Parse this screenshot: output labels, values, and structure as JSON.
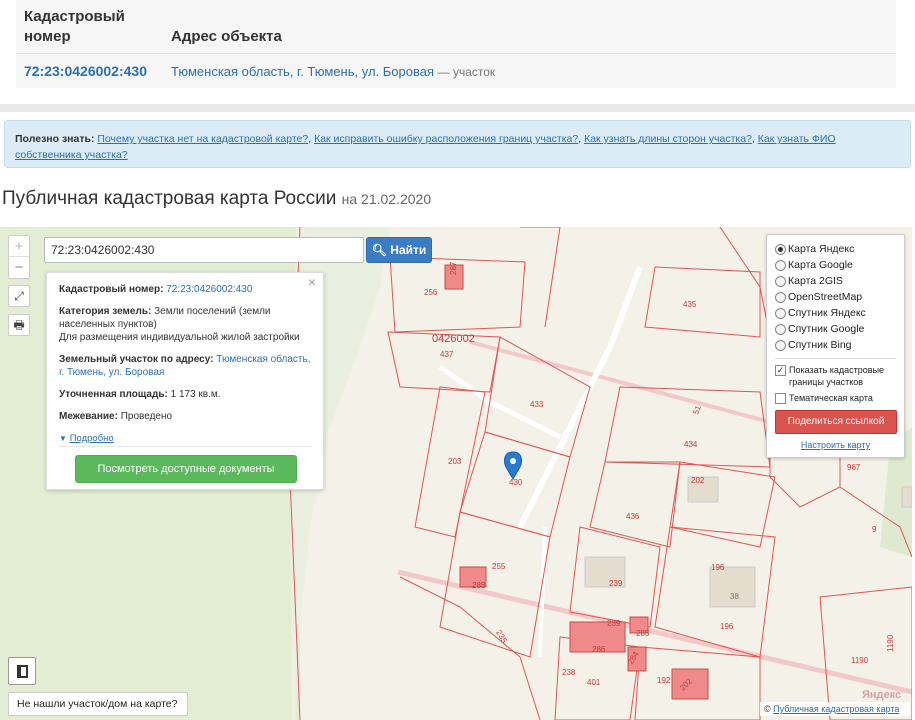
{
  "table": {
    "col_num": "Кадастровый номер",
    "col_addr": "Адрес объекта",
    "row_num": "72:23:0426002:430",
    "row_addr": "Тюменская область, г. Тюмень, ул. Боровая",
    "row_suffix": "— участок"
  },
  "info": {
    "label": "Полезно знать:",
    "link1": "Почему участка нет на кадастровой карте?",
    "link2": "Как исправить ошибку расположения границ участка?",
    "link3": "Как узнать длины сторон участка?",
    "link4": "Как узнать ФИО собственника участка?"
  },
  "title": {
    "main": "Публичная кадастровая карта России",
    "date": "на 21.02.2020"
  },
  "map": {
    "search_value": "72:23:0426002:430",
    "search_button": "Найти",
    "zoom_in": "+",
    "zoom_out": "−",
    "fullscreen_icon": "⤢",
    "print_icon": "🖶",
    "popup": {
      "num_label": "Кадастровый номер:",
      "num_value": "72:23:0426002:430",
      "cat_label": "Категория земель:",
      "cat_value": "Земли поселений (земли населенных пунктов)",
      "use_value": "Для размещения индивидуальной жилой застройки",
      "addr_label": "Земельный участок по адресу:",
      "addr_value": "Тюменская область, г. Тюмень, ул. Боровая",
      "area_label": "Уточненная площадь:",
      "area_value": "1 173 кв.м.",
      "survey_label": "Межевание:",
      "survey_value": "Проведено",
      "more": "Подробно",
      "docs_button": "Посмотреть доступные документы",
      "close": "×"
    },
    "layers": {
      "options": [
        "Карта Яндекс",
        "Карта Google",
        "Карта 2GIS",
        "OpenStreetMap",
        "Спутник Яндекс",
        "Спутник Google",
        "Спутник Bing"
      ],
      "selected": 0,
      "check1": "Показать кадастровые границы участков",
      "check2": "Тематическая карта",
      "share": "Поделиться ссылкой",
      "configure": "Настроить карту"
    },
    "not_found": "Не нашли участок/дом на карте?",
    "copyright_symbol": "©",
    "copyright_link": "Публичная кадастровая карта",
    "yandex": "Яндекс",
    "labels": [
      "256",
      "287",
      "435",
      "0426002",
      "437",
      "433",
      "51",
      "434",
      "967",
      "203",
      "430",
      "202",
      "436",
      "9",
      "255",
      "288",
      "239",
      "196",
      "38",
      "235",
      "239",
      "285",
      "196",
      "238",
      "401",
      "192",
      "1190",
      "1190",
      "286",
      "284",
      "202"
    ]
  }
}
